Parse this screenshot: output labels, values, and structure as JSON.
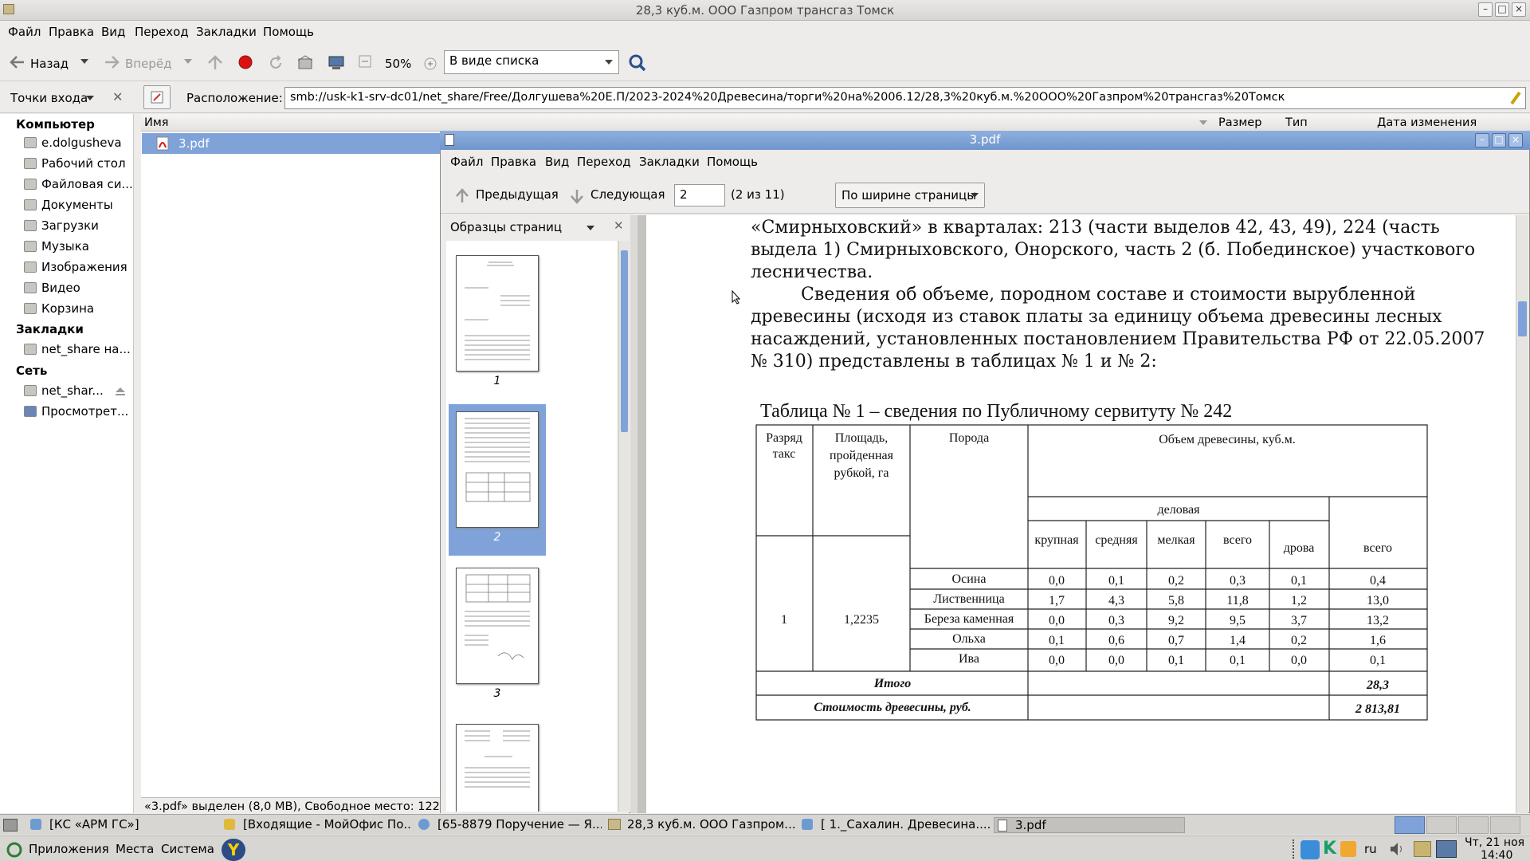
{
  "fm": {
    "title": "28,3 куб.м. ООО Газпром трансгаз Томск",
    "menu": [
      "Файл",
      "Правка",
      "Вид",
      "Переход",
      "Закладки",
      "Помощь"
    ],
    "toolbar": {
      "back": "Назад",
      "forward": "Вперёд",
      "zoom": "50%",
      "view_mode": "В виде списка"
    },
    "location_label": "Расположение:",
    "location_value": "smb://usk-k1-srv-dc01/net_share/Free/Долгушева%20Е.П/2023-2024%20Древесина/торги%20на%2006.12/28,3%20куб.м.%20ООО%20Газпром%20трансгаз%20Томск",
    "places_label": "Точки входа",
    "sidebar": {
      "computer_head": "Компьютер",
      "computer_items": [
        "e.dolgusheva",
        "Рабочий стол",
        "Файловая си...",
        "Документы",
        "Загрузки",
        "Музыка",
        "Изображения",
        "Видео",
        "Корзина"
      ],
      "bookmarks_head": "Закладки",
      "bookmarks_items": [
        "net_share на..."
      ],
      "network_head": "Сеть",
      "network_items": [
        "net_shar...",
        "Просмотрет..."
      ]
    },
    "columns": [
      "Имя",
      "Размер",
      "Тип",
      "Дата изменения"
    ],
    "file_name": "3.pdf",
    "status": "«3.pdf» выделен (8,0 MB), Свободное место: 122"
  },
  "pdf": {
    "title": "3.pdf",
    "menu": [
      "Файл",
      "Правка",
      "Вид",
      "Переход",
      "Закладки",
      "Помощь"
    ],
    "prev": "Предыдущая",
    "next": "Следующая",
    "page_value": "2",
    "page_count": "(2 из 11)",
    "fit": "По ширине страницы",
    "thumbs_label": "Образцы страниц",
    "thumb_numbers": [
      "1",
      "2",
      "3"
    ],
    "selected_page": 2,
    "body_lines": [
      "«Смирныховский» в кварталах: 213 (части выделов 42, 43, 49), 224 (часть",
      "выдела 1) Смирныховского, Онорского, часть 2 (б. Побединское) участкового",
      "лесничества.",
      "Сведения об объеме, породном составе и стоимости вырубленной",
      "древесины (исходя из ставок платы за единицу объема древесины лесных",
      "насаждений, установленных постановлением Правительства РФ от 22.05.2007",
      "№ 310) представлены в таблицах № 1 и № 2:"
    ],
    "table_title": "Таблица № 1 – сведения по Публичному сервитуту № 242",
    "table": {
      "h_rank": [
        "Разряд",
        "такс"
      ],
      "h_area": [
        "Площадь,",
        "пройденная",
        "рубкой, га"
      ],
      "h_breed": "Порода",
      "h_volume": "Объем древесины, куб.м.",
      "h_business": "деловая",
      "h_sub": [
        "крупная",
        "средняя",
        "мелкая",
        "всего",
        "дрова",
        "всего"
      ],
      "rank": "1",
      "area": "1,2235",
      "rows": [
        {
          "breed": "Осина",
          "v": [
            "0,0",
            "0,1",
            "0,2",
            "0,3",
            "0,1",
            "0,4"
          ]
        },
        {
          "breed": "Лиственница",
          "v": [
            "1,7",
            "4,3",
            "5,8",
            "11,8",
            "1,2",
            "13,0"
          ]
        },
        {
          "breed": "Береза каменная",
          "v": [
            "0,0",
            "0,3",
            "9,2",
            "9,5",
            "3,7",
            "13,2"
          ]
        },
        {
          "breed": "Ольха",
          "v": [
            "0,1",
            "0,6",
            "0,7",
            "1,4",
            "0,2",
            "1,6"
          ]
        },
        {
          "breed": "Ива",
          "v": [
            "0,0",
            "0,0",
            "0,1",
            "0,1",
            "0,0",
            "0,1"
          ]
        }
      ],
      "total_label": "Итого",
      "total_value": "28,3",
      "cost_label": "Стоимость древесины, руб.",
      "cost_value": "2 813,81"
    }
  },
  "taskbar": {
    "tasks": [
      "[КС «АРМ ГС»]",
      "[Входящие - МойОфис По...",
      "[65-8879 Поручение — Я...",
      "28,3 куб.м. ООО Газпром...",
      "[ 1._Сахалин. Древесина....",
      "3.pdf"
    ]
  },
  "panel": {
    "apps": "Приложения",
    "places": "Места",
    "system": "Система",
    "lang": "ru",
    "date": "Чт, 21 ноя",
    "time": "14:40"
  },
  "colors": {
    "selection": "#7fa3d9",
    "window_bg": "#edeceb",
    "active_title": "#6f95cc"
  }
}
